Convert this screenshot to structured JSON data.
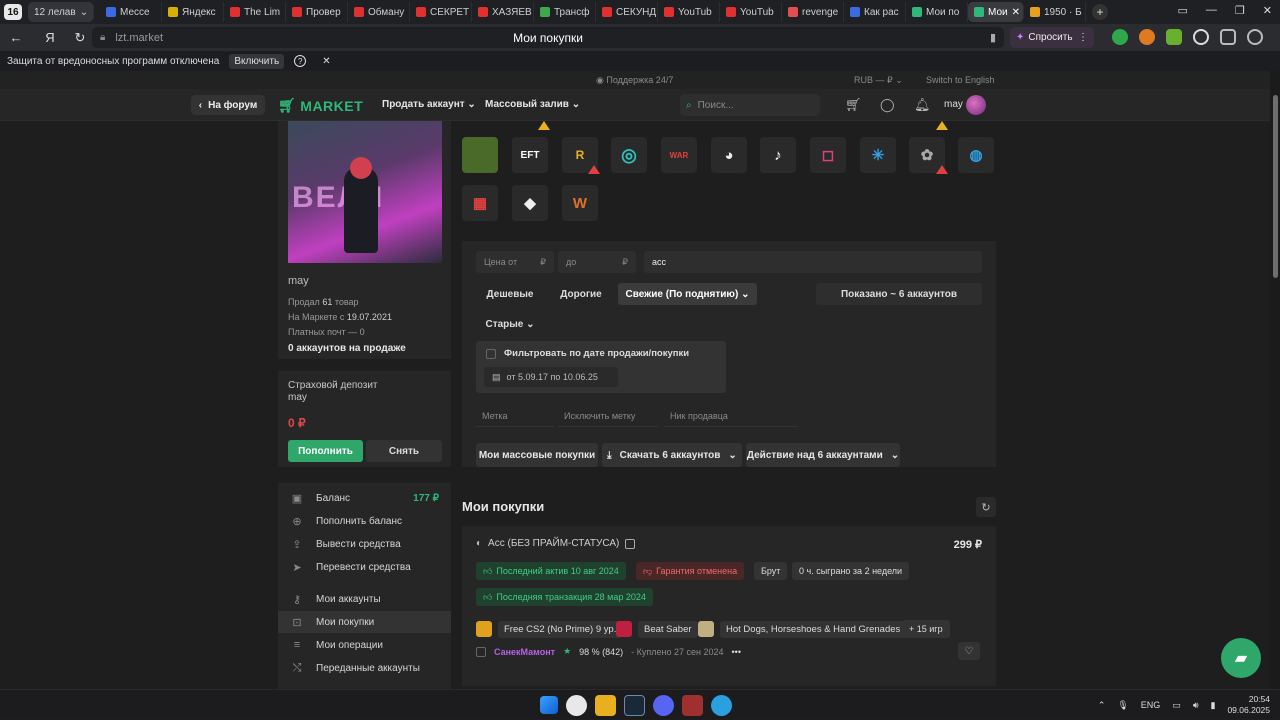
{
  "browser": {
    "tab_count": "16",
    "workspace_label": "12 лелав",
    "tabs": [
      {
        "label": "Мессе",
        "color": "#3a6be0"
      },
      {
        "label": "Яндекс",
        "color": "#d8b000"
      },
      {
        "label": "The Lim",
        "color": "#e03030"
      },
      {
        "label": "Провер",
        "color": "#e03030"
      },
      {
        "label": "Обману",
        "color": "#e03030"
      },
      {
        "label": "СЕКРЕТ",
        "color": "#e03030"
      },
      {
        "label": "ХАЗЯЕВ",
        "color": "#e03030"
      },
      {
        "label": "Трансф",
        "color": "#3fa84a"
      },
      {
        "label": "СЕКУНД",
        "color": "#e03030"
      },
      {
        "label": "YouTub",
        "color": "#e03030"
      },
      {
        "label": "YouTub",
        "color": "#e03030"
      },
      {
        "label": "revenge",
        "color": "#e05050"
      },
      {
        "label": "Как рас",
        "color": "#3a6be0"
      },
      {
        "label": "Мои по",
        "color": "#2fb87a"
      },
      {
        "label": "Мои",
        "color": "#2fb87a",
        "active": true
      },
      {
        "label": "1950 · Б",
        "color": "#e8a020"
      }
    ],
    "url": "lzt.market",
    "page_title": "Мои покупки",
    "ask_label": "Спросить",
    "infobar_text": "Защита от вредоносных программ отключена",
    "infobar_enable": "Включить"
  },
  "site": {
    "support": "Поддержка 24/7",
    "currency": "RUB — ₽",
    "switch_lang": "Switch to English",
    "forum_btn": "На форум",
    "logo": "MARKET",
    "menu_sell": "Продать аккаунт",
    "menu_mass": "Массовый залив",
    "search_placeholder": "Поиск...",
    "username": "may"
  },
  "profile": {
    "name": "may",
    "sold_prefix": "Продал",
    "sold_count": "61",
    "sold_suffix": "товар",
    "since_prefix": "На Маркете с",
    "since_date": "19.07.2021",
    "paid_mail": "Платных почт — 0",
    "on_sale": "0 аккаунтов на продаже"
  },
  "deposit": {
    "title": "Страховой депозит",
    "user": "may",
    "amount": "0 ₽",
    "topup": "Пополнить",
    "withdraw": "Снять"
  },
  "menu": [
    {
      "label": "Баланс",
      "value": "177 ₽",
      "icon": "wallet-icon"
    },
    {
      "label": "Пополнить баланс",
      "icon": "plus-circle-icon"
    },
    {
      "label": "Вывести средства",
      "icon": "upload-icon"
    },
    {
      "label": "Перевести средства",
      "icon": "send-icon"
    },
    {
      "label": "Мои аккаунты",
      "icon": "key-icon"
    },
    {
      "label": "Мои покупки",
      "icon": "cart-icon",
      "active": true
    },
    {
      "label": "Мои операции",
      "icon": "list-icon"
    },
    {
      "label": "Переданные аккаунты",
      "icon": "shuffle-icon"
    }
  ],
  "filters": {
    "price_from": "Цена от",
    "price_to": "до",
    "rub": "₽",
    "query": "acc",
    "sort_cheap": "Дешевые",
    "sort_expensive": "Дорогие",
    "sort_fresh": "Свежие (По поднятию)",
    "sort_old": "Старые",
    "shown": "Показано ~ 6 аккаунтов",
    "date_filter": "Фильтровать по дате продажи/покупки",
    "date_range": "от 5.09.17 по 10.06.25",
    "tag": "Метка",
    "exclude_tag": "Исключить метку",
    "seller_nick": "Ник продавца",
    "mass_purchases": "Мои массовые покупки",
    "download": "Скачать 6 аккаунтов",
    "action": "Действие над 6 аккаунтами"
  },
  "purchases": {
    "title": "Мои покупки",
    "item": {
      "title": "Acc (БЕЗ ПРАЙМ-СТАТУСА)",
      "price": "299 ₽",
      "last_active": "Последний актив 10 авг 2024",
      "guarantee": "Гарантия отменена",
      "brut": "Брут",
      "played": "0 ч. сыграно за 2 недели",
      "last_tx": "Последняя транзакция 28 мар 2024",
      "games": [
        {
          "name": "Free CS2 (No Prime) 9 ур.",
          "color": "#e0a020"
        },
        {
          "name": "Beat Saber",
          "color": "#c02040"
        },
        {
          "name": "Hot Dogs, Horseshoes & Hand Grenades",
          "color": "#c0b080"
        }
      ],
      "more_games": "+ 15 игр",
      "seller": "СанекМамонт",
      "rating": "98 % (842)",
      "bought": "- Куплено 27 сен 2024",
      "more": "•••"
    }
  },
  "taskbar": {
    "lang": "ENG",
    "time": "20:54",
    "date": "09.06.2025"
  }
}
